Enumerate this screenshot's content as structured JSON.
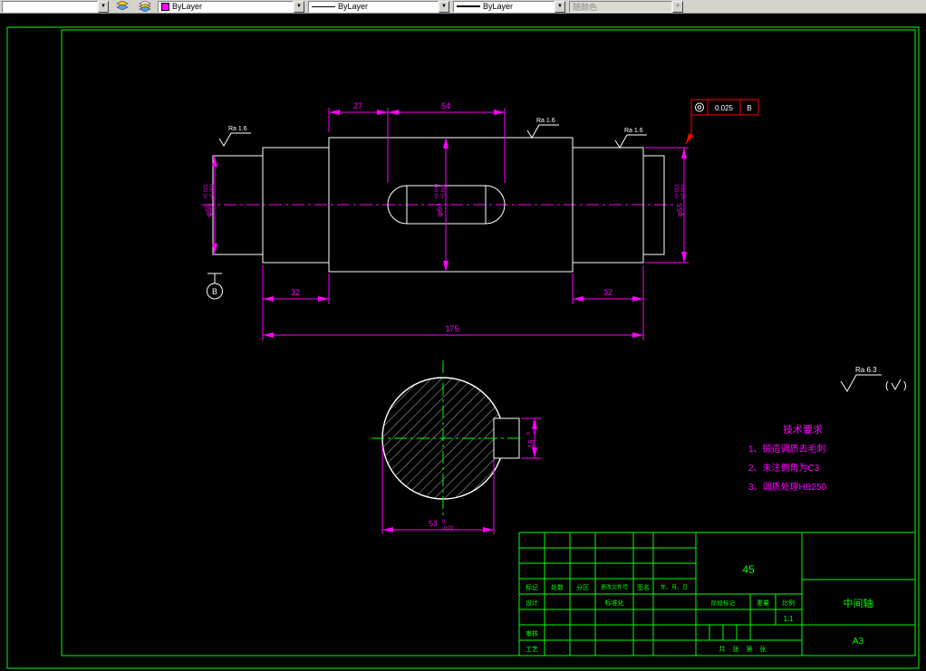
{
  "toolbar": {
    "icons": {
      "dropdown_arrow": "▼"
    },
    "color_value": "ByLayer",
    "linetype_value": "ByLayer",
    "lineweight_value": "ByLayer",
    "plot_style_value": "随颜色"
  },
  "drawing": {
    "dims": {
      "d27": "27",
      "d54": "54",
      "d32_left": "32",
      "d32_right": "32",
      "d175": "175"
    },
    "dia_left": {
      "base": "φ55",
      "sup": "+0.021",
      "sub": "+0.002"
    },
    "dia_mid": {
      "base": "φ60",
      "sup": "+0.030",
      "sub": "+0.011"
    },
    "dia_right": {
      "base": "φ55",
      "sup": "+0.021",
      "sub": "+0.002"
    },
    "section_width": {
      "base": "53",
      "sup": "0",
      "sub": "-0.20"
    },
    "section_key": {
      "base": "16",
      "sup": "0",
      "sub": "-0.043"
    },
    "roughness": {
      "ra_16": "Ra 1.6",
      "ra_63": "Ra 6.3",
      "paren_open": "(",
      "paren_close": ")"
    },
    "gdt": {
      "symbol_name": "concentricity",
      "value": "0.025",
      "datum": "B"
    },
    "datum_label": "B",
    "tech_requirements": {
      "title": "技术要求",
      "item_1": "1、锻造调质去毛刺",
      "item_2": "2、未注倒角为C3",
      "item_3": "3、调质处理HB250"
    }
  },
  "titleblock": {
    "material": "45",
    "part_name": "中间轴",
    "sheet_size": "A3",
    "scale": "1:1",
    "labels": {
      "mark": "标记",
      "count": "处数",
      "zone": "分区",
      "change_file": "更改文件号",
      "signature": "签名",
      "date": "年、月、日",
      "design": "设计",
      "standardization": "标准化",
      "review": "审核",
      "process": "工艺",
      "stage_mark": "阶段标记",
      "weight": "重量",
      "scale_label": "比例",
      "total": "共",
      "sheet1": "张",
      "page": "第",
      "sheet2": "张"
    }
  }
}
